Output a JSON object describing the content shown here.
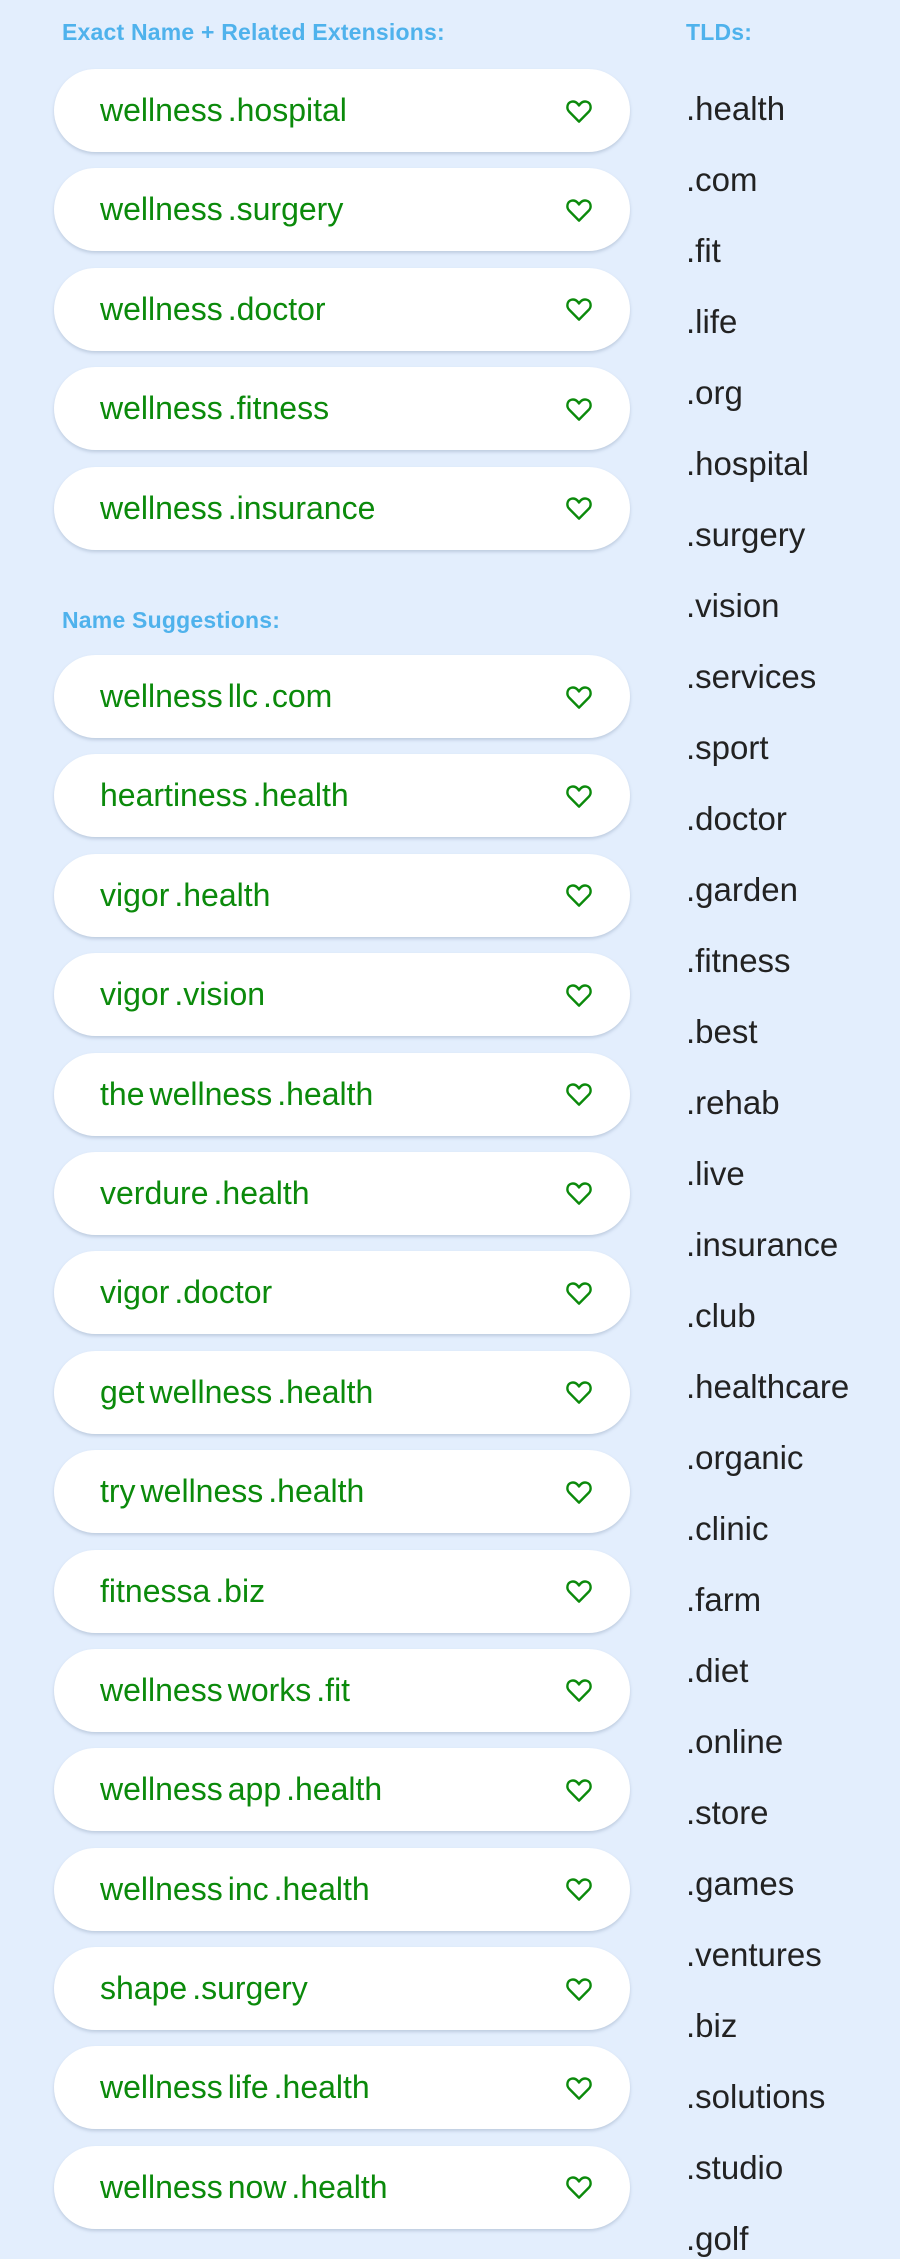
{
  "sections": {
    "exact_header": "Exact Name + Related Extensions:",
    "suggestions_header": "Name Suggestions:",
    "tlds_header": "TLDs:"
  },
  "colors": {
    "accent": "#4fb2ec",
    "domain_text": "#0b8a0b",
    "background": "#e3eefd"
  },
  "exact": [
    [
      "wellness",
      ".hospital"
    ],
    [
      "wellness",
      ".surgery"
    ],
    [
      "wellness",
      ".doctor"
    ],
    [
      "wellness",
      ".fitness"
    ],
    [
      "wellness",
      ".insurance"
    ]
  ],
  "suggestions": [
    [
      "wellness",
      "llc",
      ".com"
    ],
    [
      "heartiness",
      ".health"
    ],
    [
      "vigor",
      ".health"
    ],
    [
      "vigor",
      ".vision"
    ],
    [
      "the",
      "wellness",
      ".health"
    ],
    [
      "verdure",
      ".health"
    ],
    [
      "vigor",
      ".doctor"
    ],
    [
      "get",
      "wellness",
      ".health"
    ],
    [
      "try",
      "wellness",
      ".health"
    ],
    [
      "fitnessa",
      ".biz"
    ],
    [
      "wellness",
      "works",
      ".fit"
    ],
    [
      "wellness",
      "app",
      ".health"
    ],
    [
      "wellness",
      "inc",
      ".health"
    ],
    [
      "shape",
      ".surgery"
    ],
    [
      "wellness",
      "life",
      ".health"
    ],
    [
      "wellness",
      "now",
      ".health"
    ]
  ],
  "tlds": [
    ".health",
    ".com",
    ".fit",
    ".life",
    ".org",
    ".hospital",
    ".surgery",
    ".vision",
    ".services",
    ".sport",
    ".doctor",
    ".garden",
    ".fitness",
    ".best",
    ".rehab",
    ".live",
    ".insurance",
    ".club",
    ".healthcare",
    ".organic",
    ".clinic",
    ".farm",
    ".diet",
    ".online",
    ".store",
    ".games",
    ".ventures",
    ".biz",
    ".solutions",
    ".studio",
    ".golf"
  ],
  "icons": {
    "favorite": "heart-outline-icon"
  }
}
